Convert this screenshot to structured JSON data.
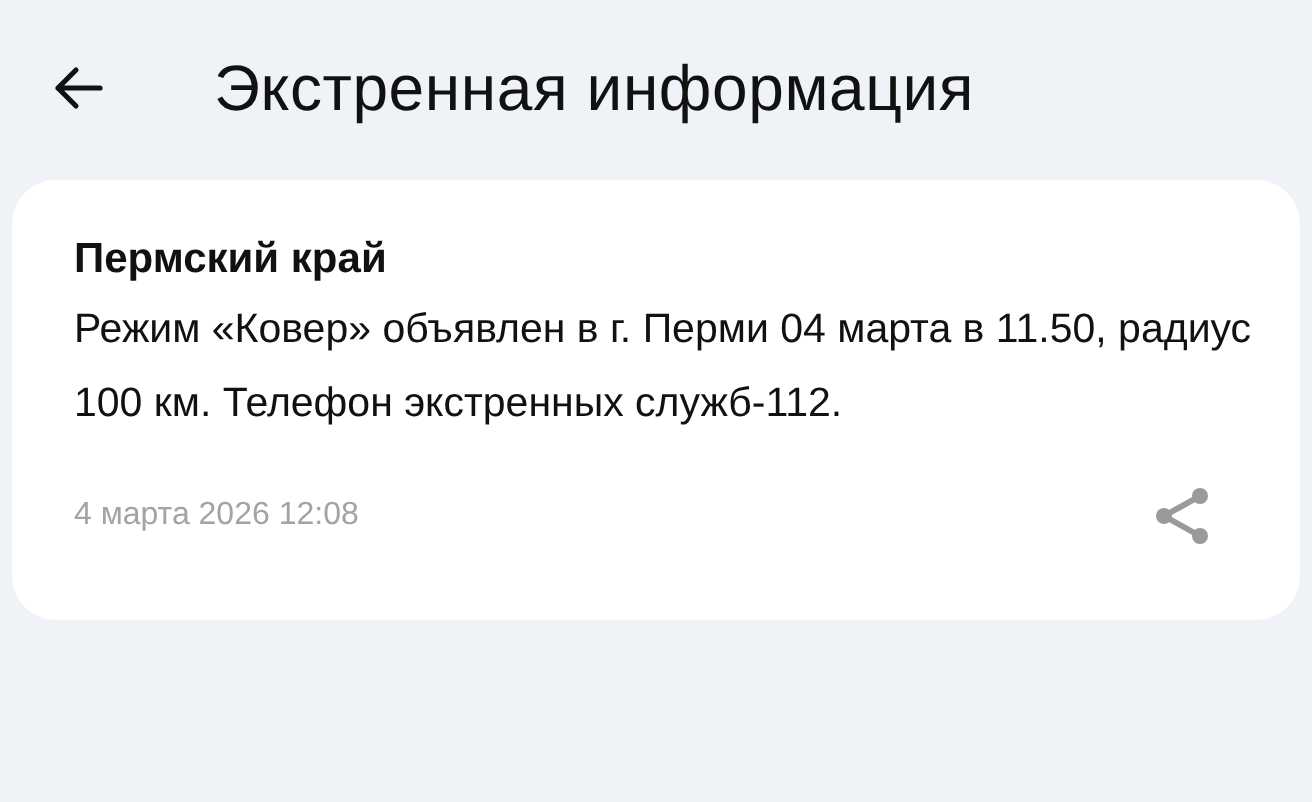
{
  "header": {
    "title": "Экстренная информация"
  },
  "alerts": [
    {
      "region": "Пермский край",
      "message": "Режим «Ковер» объявлен в г. Перми 04 марта в 11.50, радиус 100 км. Телефон экстренных служб-112.",
      "date": "4 марта 2026 12:08"
    }
  ]
}
